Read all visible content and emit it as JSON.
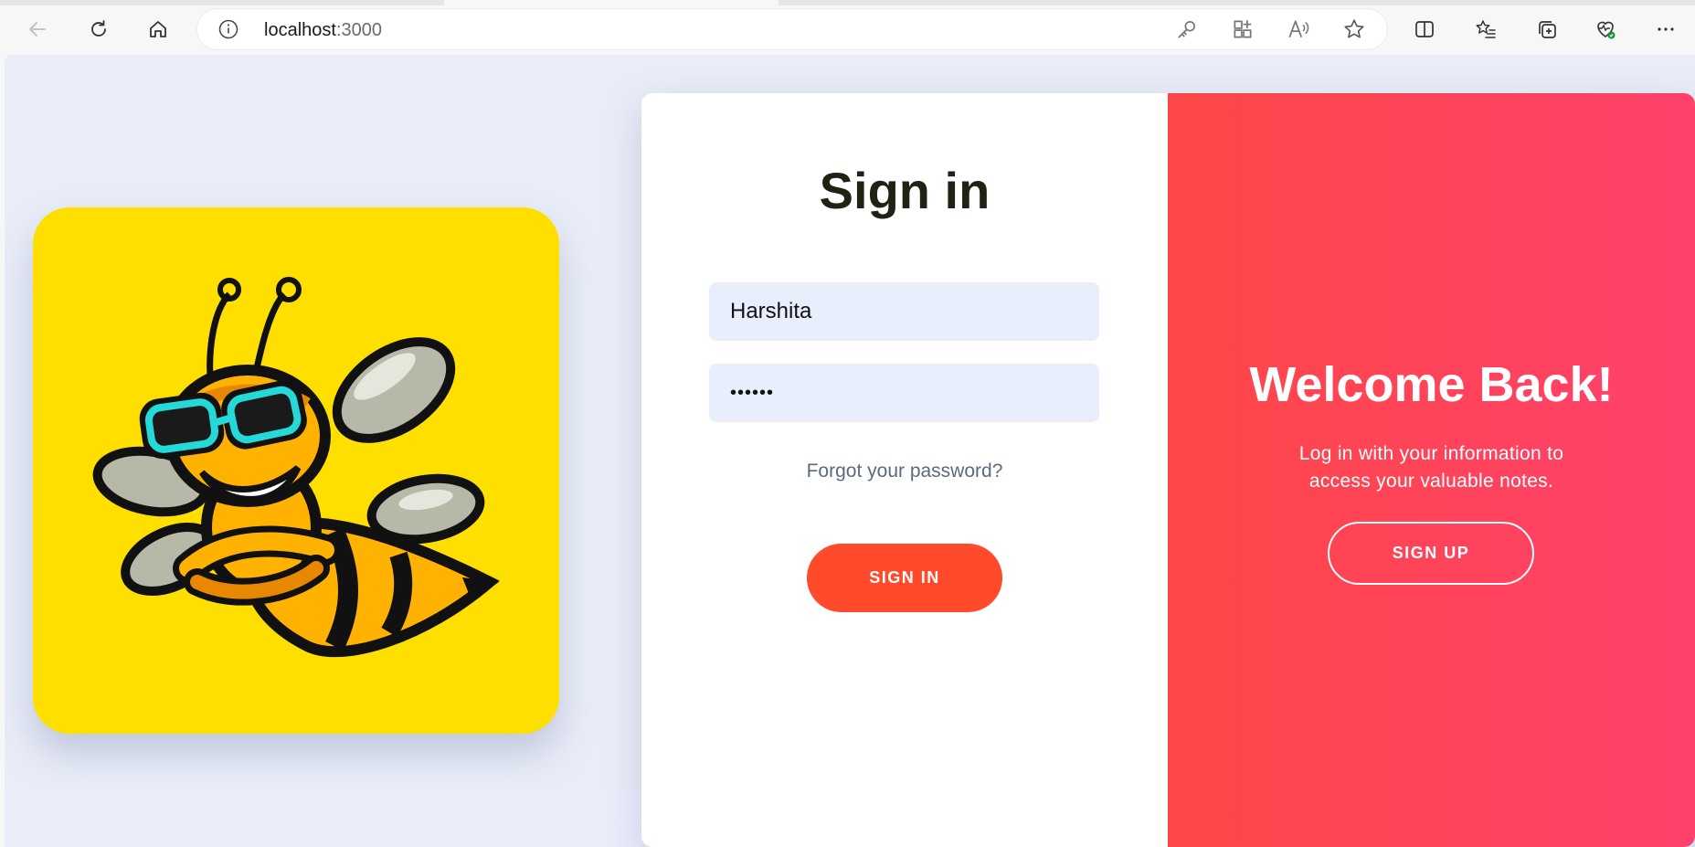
{
  "browser": {
    "url_host": "localhost",
    "url_port": ":3000",
    "icons": [
      "back-icon",
      "refresh-icon",
      "home-icon",
      "site-info-icon",
      "key-icon",
      "apps-icon",
      "read-aloud-icon",
      "favorite-star-icon",
      "split-screen-icon",
      "favorites-icon",
      "collections-icon",
      "browser-essentials-icon",
      "more-icon"
    ]
  },
  "logo": {
    "icon": "bee-mascot-icon"
  },
  "signin": {
    "title": "Sign in",
    "username_value": "Harshita",
    "password_value": "••••••",
    "forgot_link": "Forgot your password?",
    "button_label": "SIGN IN"
  },
  "overlay": {
    "title": "Welcome Back!",
    "subtitle": "Log in with your information to access your valuable notes.",
    "button_label": "SIGN UP"
  },
  "colors": {
    "accent": "#ff4b2b",
    "gradient_start": "#ff4647",
    "gradient_end": "#ff416c",
    "logo_background": "#ffdf00",
    "page_background": "#e9edf8"
  }
}
